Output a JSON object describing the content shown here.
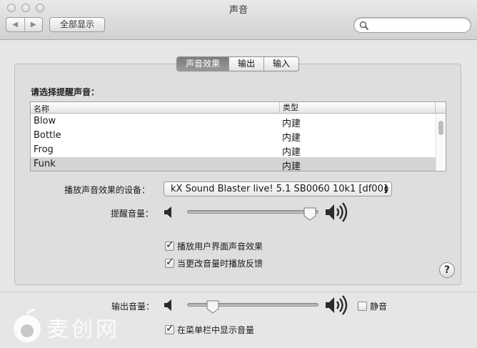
{
  "window": {
    "title": "声音"
  },
  "toolbar": {
    "back_icon": "chevron-left-icon",
    "forward_icon": "chevron-right-icon",
    "show_all_label": "全部显示",
    "search_value": "",
    "search_placeholder": ""
  },
  "tabs": [
    {
      "label": "声音效果",
      "active": true
    },
    {
      "label": "输出",
      "active": false
    },
    {
      "label": "输入",
      "active": false
    }
  ],
  "sound_effects": {
    "choose_label": "请选择提醒声音：",
    "columns": [
      "名称",
      "类型"
    ],
    "rows": [
      {
        "name": "Blow",
        "type": "内建",
        "selected": false
      },
      {
        "name": "Bottle",
        "type": "内建",
        "selected": false
      },
      {
        "name": "Frog",
        "type": "内建",
        "selected": false
      },
      {
        "name": "Funk",
        "type": "内建",
        "selected": true
      }
    ],
    "device_label": "播放声音效果的设备：",
    "device_value": "kX Sound Blaster live! 5.1 SB0060 10k1 [df00]",
    "alert_volume_label": "提醒音量：",
    "alert_volume_level": 0.98,
    "checkbox_ui_effects": {
      "label": "播放用户界面声音效果",
      "checked": true
    },
    "checkbox_feedback": {
      "label": "当更改音量时播放反馈",
      "checked": true
    },
    "help_label": "?"
  },
  "output": {
    "volume_label": "输出音量：",
    "volume_level": 0.16,
    "mute": {
      "label": "静音",
      "checked": false
    },
    "show_in_menubar": {
      "label": "在菜单栏中显示音量",
      "checked": true
    }
  },
  "watermark": {
    "text": "麦创网"
  },
  "colors": {
    "selected_row": "#d4d4d4",
    "active_tab": "#8a8a8a"
  }
}
